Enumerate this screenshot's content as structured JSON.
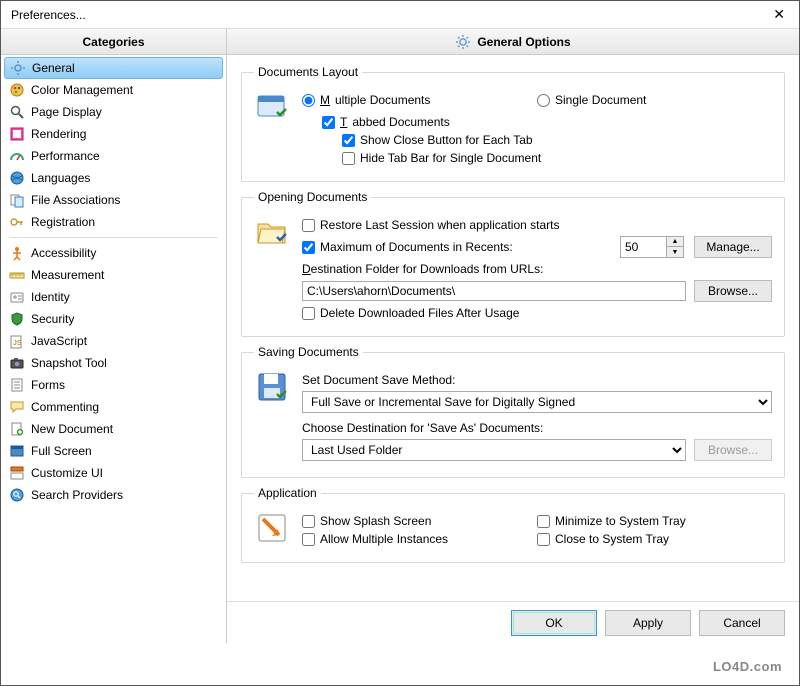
{
  "title": "Preferences...",
  "sidebar": {
    "header": "Categories",
    "groups": [
      [
        {
          "label": "General",
          "icon": "gear"
        },
        {
          "label": "Color Management",
          "icon": "palette"
        },
        {
          "label": "Page Display",
          "icon": "magnifier"
        },
        {
          "label": "Rendering",
          "icon": "render"
        },
        {
          "label": "Performance",
          "icon": "gauge"
        },
        {
          "label": "Languages",
          "icon": "globe"
        },
        {
          "label": "File Associations",
          "icon": "file-assoc"
        },
        {
          "label": "Registration",
          "icon": "key"
        }
      ],
      [
        {
          "label": "Accessibility",
          "icon": "access"
        },
        {
          "label": "Measurement",
          "icon": "ruler"
        },
        {
          "label": "Identity",
          "icon": "id"
        },
        {
          "label": "Security",
          "icon": "shield"
        },
        {
          "label": "JavaScript",
          "icon": "js"
        },
        {
          "label": "Snapshot Tool",
          "icon": "snapshot"
        },
        {
          "label": "Forms",
          "icon": "form"
        },
        {
          "label": "Commenting",
          "icon": "comment"
        },
        {
          "label": "New Document",
          "icon": "newdoc"
        },
        {
          "label": "Full Screen",
          "icon": "fullscreen"
        },
        {
          "label": "Customize UI",
          "icon": "customize"
        },
        {
          "label": "Search Providers",
          "icon": "search"
        }
      ]
    ]
  },
  "main": {
    "header": "General Options",
    "documents_layout": {
      "legend": "Documents Layout",
      "multiple": "Multiple Documents",
      "single": "Single Document",
      "tabbed": "Tabbed Documents",
      "show_close": "Show Close Button for Each Tab",
      "hide_tab_bar": "Hide Tab Bar for Single Document"
    },
    "opening": {
      "legend": "Opening Documents",
      "restore": "Restore Last Session when application starts",
      "max_recents": "Maximum of Documents in Recents:",
      "max_recents_value": "50",
      "manage": "Manage...",
      "dest_folder_label": "Destination Folder for Downloads from URLs:",
      "dest_folder_value": "C:\\Users\\ahorn\\Documents\\",
      "browse": "Browse...",
      "delete_downloaded": "Delete Downloaded Files After Usage"
    },
    "saving": {
      "legend": "Saving Documents",
      "save_method_label": "Set Document Save Method:",
      "save_method_value": "Full Save or Incremental Save for Digitally Signed",
      "choose_dest_label": "Choose Destination for 'Save As' Documents:",
      "choose_dest_value": "Last Used Folder",
      "browse": "Browse..."
    },
    "application": {
      "legend": "Application",
      "splash": "Show Splash Screen",
      "minimize_tray": "Minimize to System Tray",
      "multi_instance": "Allow Multiple Instances",
      "close_tray": "Close to System Tray"
    }
  },
  "buttons": {
    "ok": "OK",
    "apply": "Apply",
    "cancel": "Cancel"
  },
  "watermark": "LO4D.com"
}
